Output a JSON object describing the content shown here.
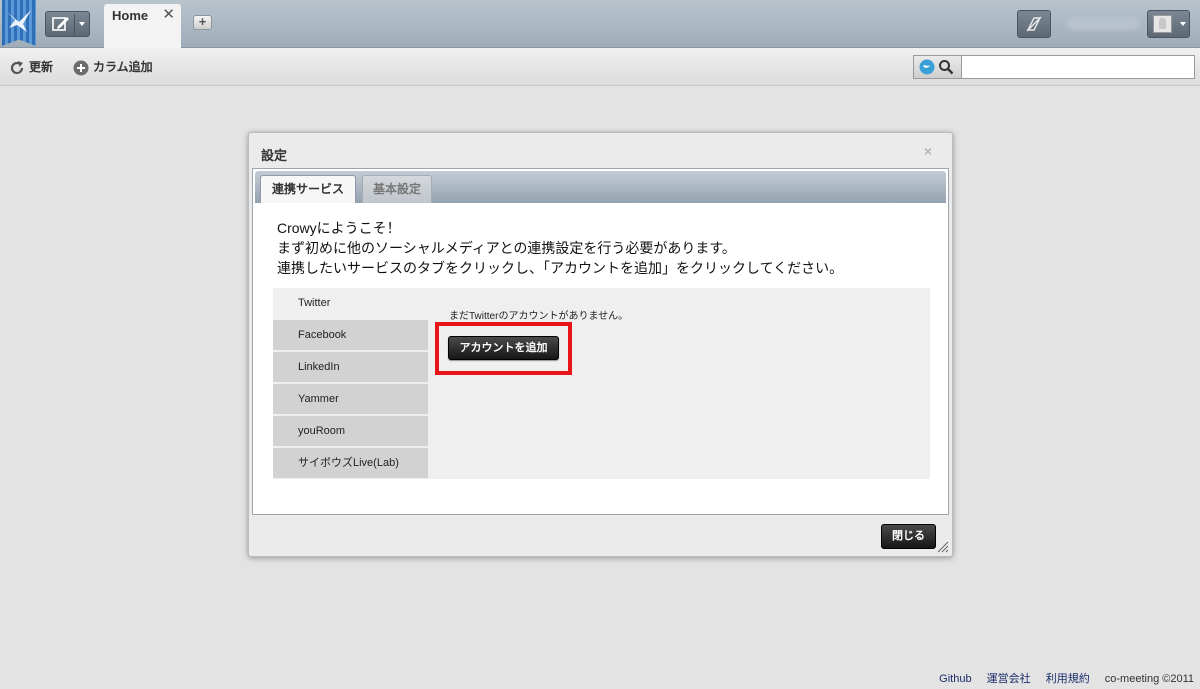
{
  "tabs": {
    "home_label": "Home",
    "close_glyph": "✕",
    "new_tab_glyph": "+"
  },
  "toolbar": {
    "refresh_label": "更新",
    "add_column_label": "カラム追加"
  },
  "search": {
    "value": "",
    "placeholder": ""
  },
  "modal": {
    "title": "設定",
    "close_glyph": "×",
    "tabs": [
      {
        "label": "連携サービス",
        "active": true
      },
      {
        "label": "基本設定",
        "active": false
      }
    ],
    "welcome_lines": [
      "Crowyにようこそ！",
      "まず初めに他のソーシャルメディアとの連携設定を行う必要があります。",
      "連携したいサービスのタブをクリックし、「アカウントを追加」をクリックしてください。"
    ],
    "services": [
      "Twitter",
      "Facebook",
      "LinkedIn",
      "Yammer",
      "youRoom",
      "サイボウズLive(Lab)"
    ],
    "selected_service": "Twitter",
    "no_account_text": "まだTwitterのアカウントがありません。",
    "add_account_label": "アカウントを追加",
    "close_button_label": "閉じる"
  },
  "footer": {
    "links": [
      "Github",
      "運営会社",
      "利用規約"
    ],
    "copyright": "co-meeting ©2011"
  },
  "colors": {
    "highlight": "#e8141a",
    "topbar": "#a8b4bf",
    "brand_blue": "#2f6fb7"
  }
}
